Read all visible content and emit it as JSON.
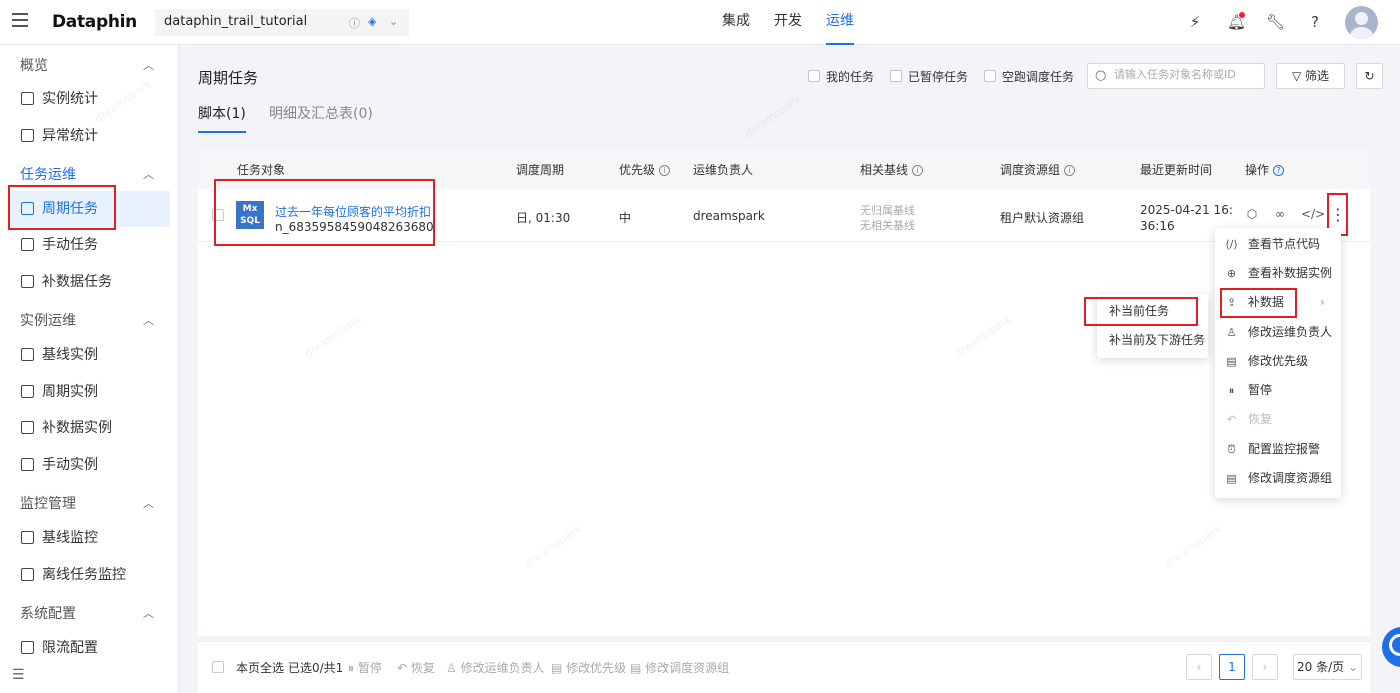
{
  "header": {
    "brand": "Dataphin",
    "project": "dataphin_trail_tutorial",
    "nav": [
      "集成",
      "开发",
      "运维"
    ],
    "nav_active_index": 2,
    "brand_color": "#1e6fe8"
  },
  "sidebar": {
    "groups": [
      {
        "label": "概览",
        "items": [
          "实例统计",
          "异常统计"
        ]
      },
      {
        "label": "任务运维",
        "items": [
          "周期任务",
          "手动任务",
          "补数据任务"
        ]
      },
      {
        "label": "实例运维",
        "items": [
          "基线实例",
          "周期实例",
          "补数据实例",
          "手动实例"
        ]
      },
      {
        "label": "监控管理",
        "items": [
          "基线监控",
          "离线任务监控"
        ]
      },
      {
        "label": "系统配置",
        "items": [
          "限流配置"
        ]
      }
    ],
    "active_group": "任务运维",
    "active_item": "周期任务"
  },
  "main": {
    "title": "周期任务",
    "filters": {
      "my_tasks": "我的任务",
      "paused": "已暂停任务",
      "dry_run": "空跑调度任务"
    },
    "search_placeholder": "请输入任务对象名称或ID",
    "filter_button": "筛选",
    "tabs": [
      "脚本(1)",
      "明细及汇总表(0)"
    ],
    "columns": [
      "任务对象",
      "调度周期",
      "优先级",
      "运维负责人",
      "相关基线",
      "调度资源组",
      "最近更新时间",
      "操作"
    ],
    "row": {
      "icon": "MxSQL",
      "name": "过去一年每位顾客的平均折扣",
      "id": "n_6835958459048263680",
      "schedule": "日, 01:30",
      "priority": "中",
      "owner": "dreamspark",
      "baseline": [
        "无归属基线",
        "无相关基线"
      ],
      "resource_group": "租户默认资源组",
      "updated": "2025-04-21 16:36:16"
    }
  },
  "action_menu": [
    {
      "icon": "code-icon",
      "label": "查看节点代码",
      "enabled": true
    },
    {
      "icon": "plus-circle-icon",
      "label": "查看补数据实例",
      "enabled": true
    },
    {
      "icon": "upload-icon",
      "label": "补数据",
      "enabled": true,
      "submenu": true
    },
    {
      "icon": "user-icon",
      "label": "修改运维负责人",
      "enabled": true
    },
    {
      "icon": "edit-icon",
      "label": "修改优先级",
      "enabled": true
    },
    {
      "icon": "pause-icon",
      "label": "暂停",
      "enabled": true
    },
    {
      "icon": "undo-icon",
      "label": "恢复",
      "enabled": false
    },
    {
      "icon": "alarm-icon",
      "label": "配置监控报警",
      "enabled": true
    },
    {
      "icon": "edit-group-icon",
      "label": "修改调度资源组",
      "enabled": true
    }
  ],
  "backfill_submenu": [
    "补当前任务",
    "补当前及下游任务"
  ],
  "footer": {
    "select_all": "本页全选",
    "selected": "已选0/共1",
    "actions": [
      "暂停",
      "恢复",
      "修改运维负责人",
      "修改优先级",
      "修改调度资源组"
    ],
    "page": "1",
    "page_size": "20 条/页"
  },
  "watermark": [
    "dreamspark",
    "13755843634021"
  ]
}
